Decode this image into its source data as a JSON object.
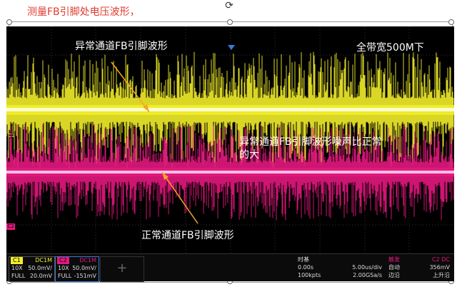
{
  "caption": "测量FB引脚处电压波形，",
  "annotations": {
    "abnormal_label": "异常通道FB引脚波形",
    "bandwidth_label": "全带宽500M下",
    "noise_comment_line1": "异常通道FB引脚波形噪声比正常",
    "noise_comment_line2": "的大",
    "normal_label": "正常通道FB引脚波形"
  },
  "markers": {
    "c1": "C1",
    "c2": "C2"
  },
  "channels": [
    {
      "name": "C1",
      "coupling": "DC1M",
      "probe": "10X",
      "scale": "50.0mV/",
      "bw": "FULL",
      "offset": "20.0mV",
      "color": "#f2ee2a"
    },
    {
      "name": "C2",
      "coupling": "DC1M",
      "probe": "10X",
      "scale": "50.0mV/",
      "bw": "FULL",
      "offset": "-151mV",
      "color": "#e4187f"
    }
  ],
  "timebase": {
    "label": "时基",
    "delay": "0.00s",
    "scale": "5.00us/div",
    "points": "100kpts",
    "rate": "2.00GSa/s"
  },
  "trigger": {
    "label": "触发",
    "source": "C2 DC",
    "mode": "自动",
    "level": "356mV",
    "type": "边沿",
    "slope": "上升沿"
  },
  "colors": {
    "c1": "#f2ee2a",
    "c2": "#e4187f",
    "arrow": "#f5a623",
    "caption": "#e03c31",
    "trigger_marker": "#3a7bd5"
  }
}
